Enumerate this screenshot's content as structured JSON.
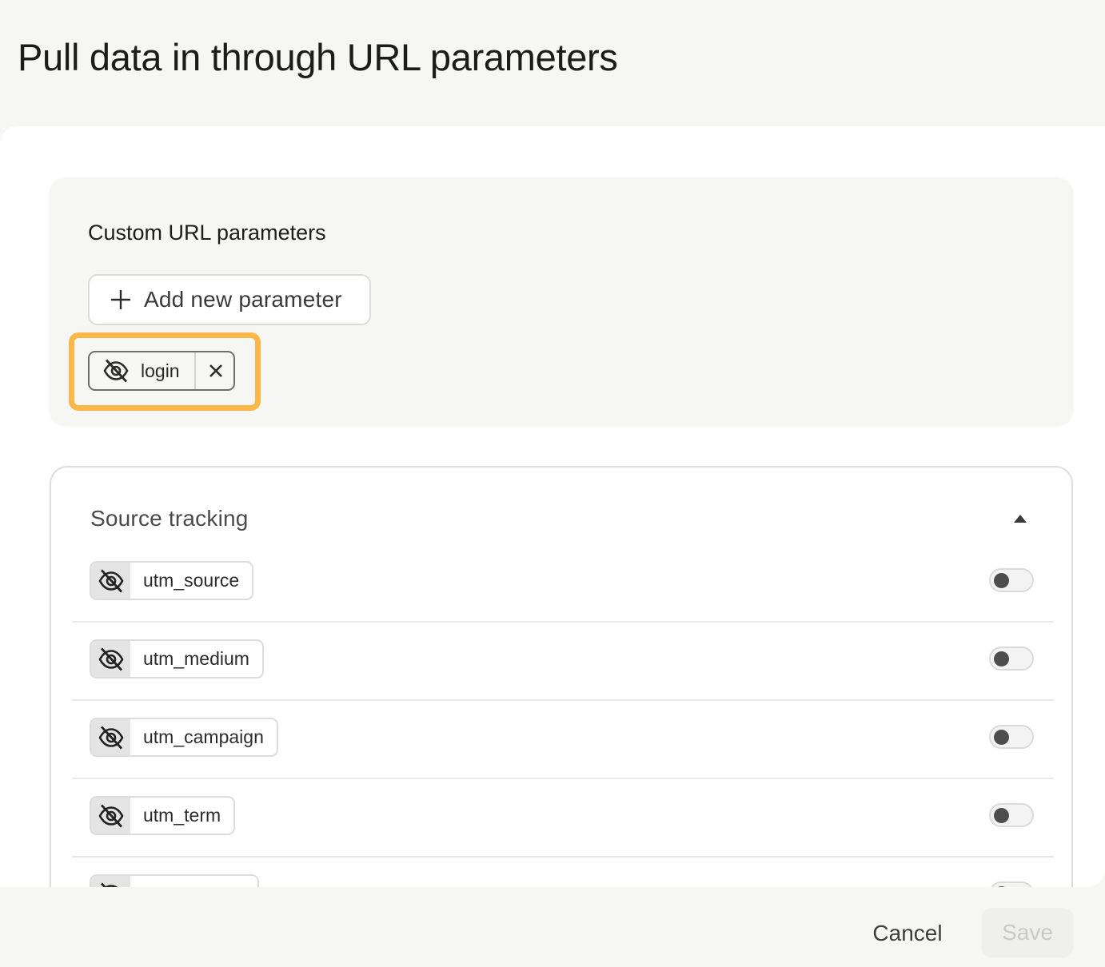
{
  "page": {
    "title": "Pull data in through URL parameters"
  },
  "custom": {
    "title": "Custom URL parameters",
    "add_button_label": "Add new parameter",
    "params": [
      {
        "name": "login",
        "visibility_icon": "eye-off-icon",
        "remove_icon": "close-icon"
      }
    ]
  },
  "source": {
    "title": "Source tracking",
    "collapse_icon": "triangle-up-icon",
    "params": [
      {
        "name": "utm_source",
        "enabled": false,
        "visibility_icon": "eye-off-icon"
      },
      {
        "name": "utm_medium",
        "enabled": false,
        "visibility_icon": "eye-off-icon"
      },
      {
        "name": "utm_campaign",
        "enabled": false,
        "visibility_icon": "eye-off-icon"
      },
      {
        "name": "utm_term",
        "enabled": false,
        "visibility_icon": "eye-off-icon"
      }
    ]
  },
  "footer": {
    "cancel_label": "Cancel",
    "save_label": "Save"
  },
  "colors": {
    "highlight": "#fbb848",
    "toggle_knob": "#4d4d4d",
    "save_disabled_text": "#c9c9c9"
  }
}
